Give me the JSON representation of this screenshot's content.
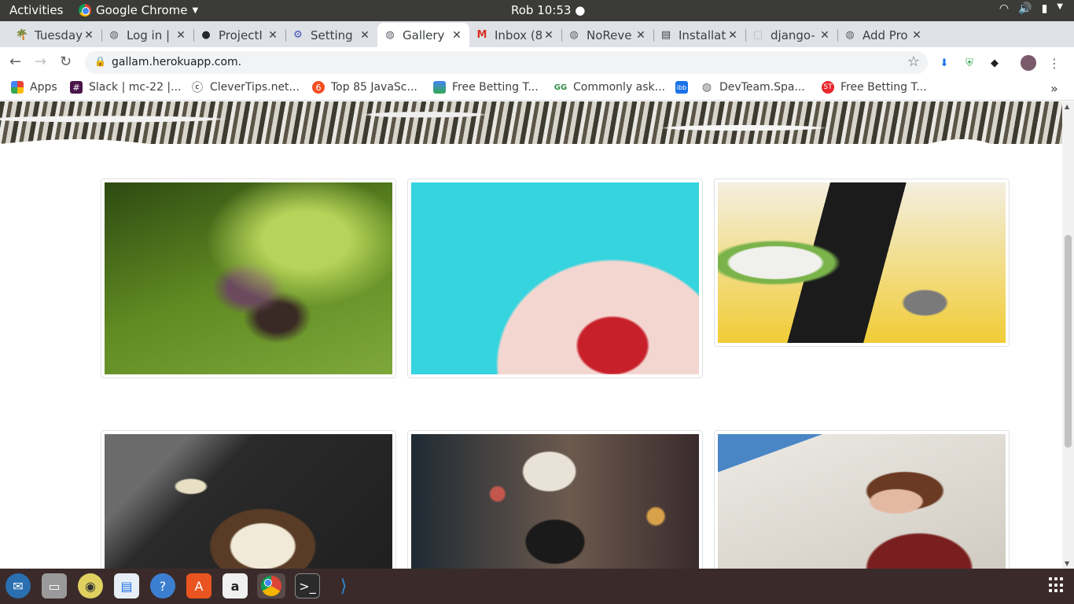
{
  "system_bar": {
    "activities": "Activities",
    "app_name": "Google Chrome",
    "clock": "Rob 10:53 ●",
    "tray_icons": [
      "wifi-icon",
      "volume-icon",
      "battery-icon",
      "chevron-down-icon"
    ]
  },
  "tabs": [
    {
      "title": "Tuesday",
      "icon": "tree-icon",
      "active": false
    },
    {
      "title": "Log in | ",
      "icon": "globe-icon",
      "active": false
    },
    {
      "title": "ProjectI",
      "icon": "github-icon",
      "active": false
    },
    {
      "title": "Setting",
      "icon": "gear-icon",
      "active": false
    },
    {
      "title": "Gallery",
      "icon": "globe-icon",
      "active": true
    },
    {
      "title": "Inbox (8",
      "icon": "gmail-icon",
      "active": false
    },
    {
      "title": "NoReve",
      "icon": "globe-icon",
      "active": false
    },
    {
      "title": "Installat",
      "icon": "doc-icon",
      "active": false
    },
    {
      "title": "django-",
      "icon": "cube-icon",
      "active": false
    },
    {
      "title": "Add Pro",
      "icon": "globe-icon",
      "active": false
    }
  ],
  "address_bar": {
    "url": "gallam.herokuapp.com."
  },
  "bookmarks": [
    {
      "label": "Apps",
      "icon": "apps-grid-icon",
      "color": "#e94235"
    },
    {
      "label": "Slack | mc-22 |...",
      "icon": "slack-icon",
      "color": "#4a154b"
    },
    {
      "label": "CleverTips.net...",
      "icon": "clevertips-icon",
      "color": "#333333"
    },
    {
      "label": "Top 85 JavaSc...",
      "icon": "javascript-icon",
      "color": "#f25022"
    },
    {
      "label": "Free Betting T...",
      "icon": "betting-icon",
      "color": "#34a853"
    },
    {
      "label": "Commonly ask...",
      "icon": "geeksforgeeks-icon",
      "color": "#2f8d46"
    },
    {
      "label": "",
      "icon": "ibb-icon",
      "color": "#1a73e8"
    },
    {
      "label": "DevTeam.Spa...",
      "icon": "globe-icon",
      "color": "#5f6368"
    },
    {
      "label": "Free Betting T...",
      "icon": "betting-icon",
      "color": "#e8262b"
    }
  ],
  "gallery": {
    "photos": [
      {
        "subject": "child-lying-on-grass"
      },
      {
        "subject": "strawberries-on-pink-plate"
      },
      {
        "subject": "fruit-bowl-tablet-camera"
      },
      {
        "subject": "cake-on-dark-table"
      },
      {
        "subject": "photographer-with-camera-city"
      },
      {
        "subject": "woman-with-sunglasses-shopping"
      }
    ]
  },
  "dock": {
    "apps": [
      "thunderbird-icon",
      "files-icon",
      "rhythmbox-icon",
      "writer-icon",
      "help-icon",
      "software-center-icon",
      "amazon-icon",
      "chrome-icon",
      "terminal-icon",
      "vscode-icon"
    ]
  }
}
